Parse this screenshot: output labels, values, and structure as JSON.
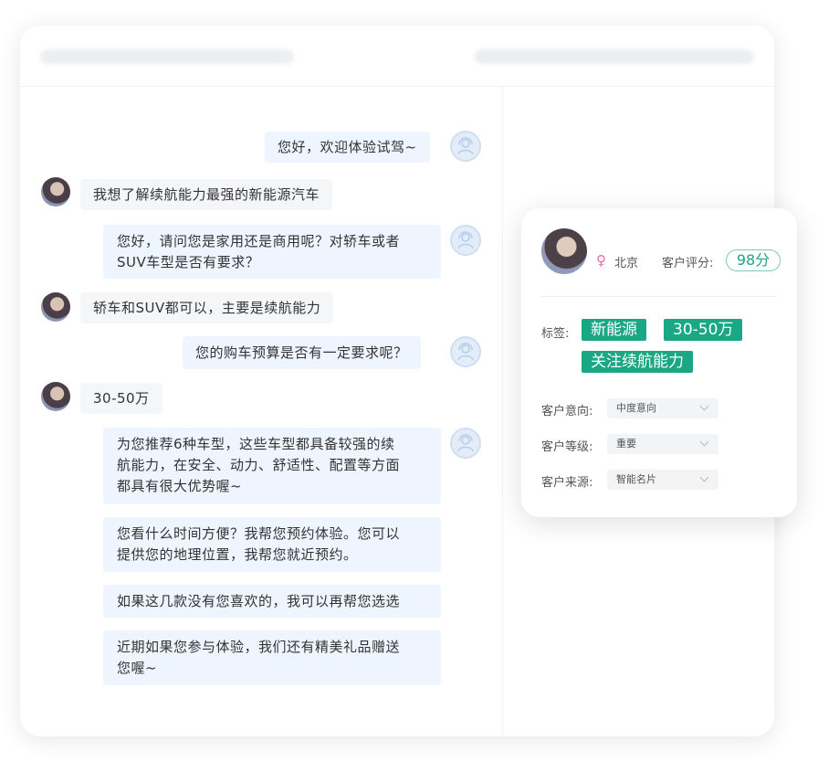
{
  "chat": {
    "messages": [
      {
        "from": "bot",
        "text": "您好，欢迎体验试驾~"
      },
      {
        "from": "user",
        "text": "我想了解续航能力最强的新能源汽车"
      },
      {
        "from": "bot",
        "text": "您好，请问您是家用还是商用呢？对轿车或者\nSUV车型是否有要求？"
      },
      {
        "from": "user",
        "text": "轿车和SUV都可以，主要是续航能力"
      },
      {
        "from": "bot",
        "text": "您的购车预算是否有一定要求呢？"
      },
      {
        "from": "user",
        "text": "30-50万"
      },
      {
        "from": "bot",
        "text": "为您推荐6种车型，这些车型都具备较强的续\n航能力，在安全、动力、舒适性、配置等方面\n都具有很大优势喔~"
      },
      {
        "from": "bot",
        "text": "您看什么时间方便？我帮您预约体验。您可以\n提供您的地理位置，我帮您就近预约。"
      },
      {
        "from": "bot",
        "text": "如果这几款没有您喜欢的，我可以再帮您选选"
      },
      {
        "from": "bot",
        "text": "近期如果您参与体验，我们还有精美礼品赠送\n您喔~"
      }
    ]
  },
  "profile": {
    "gender_icon": "female-icon",
    "gender_symbol": "♀",
    "city": "北京",
    "score_label": "客户评分:",
    "score": "98分",
    "tags_label": "标签:",
    "tags": [
      "新能源",
      "30-50万",
      "关注续航能力"
    ],
    "fields": [
      {
        "label": "客户意向:",
        "value": "中度意向"
      },
      {
        "label": "客户等级:",
        "value": "重要"
      },
      {
        "label": "客户来源:",
        "value": "智能名片"
      }
    ]
  },
  "colors": {
    "accent": "#1aa783",
    "bot_bubble": "#eef5fe",
    "user_bubble": "#f5f6f8",
    "female": "#f06ca0"
  }
}
